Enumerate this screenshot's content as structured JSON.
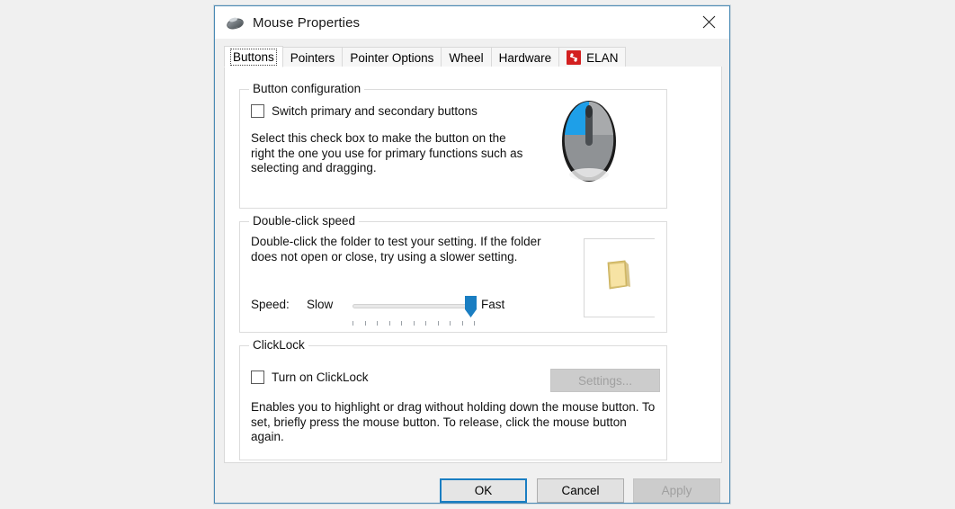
{
  "window": {
    "title": "Mouse Properties",
    "title_icon": "mouse-icon",
    "close_icon": "close-icon"
  },
  "tabs": [
    {
      "label": "Buttons",
      "selected": true,
      "icon": null
    },
    {
      "label": "Pointers",
      "selected": false,
      "icon": null
    },
    {
      "label": "Pointer Options",
      "selected": false,
      "icon": null
    },
    {
      "label": "Wheel",
      "selected": false,
      "icon": null
    },
    {
      "label": "Hardware",
      "selected": false,
      "icon": null
    },
    {
      "label": "ELAN",
      "selected": false,
      "icon": "elan-logo-icon"
    }
  ],
  "button_configuration": {
    "group_title": "Button configuration",
    "switch_checkbox_label": "Switch primary and secondary buttons",
    "switch_checkbox_checked": false,
    "description": "Select this check box to make the button on the right the one you use for primary functions such as selecting and dragging.",
    "image": "mouse-illustration"
  },
  "double_click_speed": {
    "group_title": "Double-click speed",
    "description": "Double-click the folder to test your setting. If the folder does not open or close, try using a slower setting.",
    "speed_label": "Speed:",
    "slow_label": "Slow",
    "fast_label": "Fast",
    "slider_value": 92,
    "slider_min": 0,
    "slider_max": 100,
    "tick_count": 11,
    "test_icon": "folder-icon"
  },
  "clicklock": {
    "group_title": "ClickLock",
    "checkbox_label": "Turn on ClickLock",
    "checkbox_checked": false,
    "settings_button_label": "Settings...",
    "settings_button_enabled": false,
    "description": "Enables you to highlight or drag without holding down the mouse button. To set, briefly press the mouse button. To release, click the mouse button again."
  },
  "footer": {
    "ok_label": "OK",
    "cancel_label": "Cancel",
    "apply_label": "Apply",
    "apply_enabled": false
  },
  "colors": {
    "window_border": "#4a8ab5",
    "accent_blue": "#1a7ec2",
    "slider_thumb": "#1a7ec2",
    "elan_red": "#d32020",
    "folder_yellow": "#f7e0a0",
    "mouse_blue": "#1e9fe8",
    "page_background": "#f0f0f0"
  }
}
